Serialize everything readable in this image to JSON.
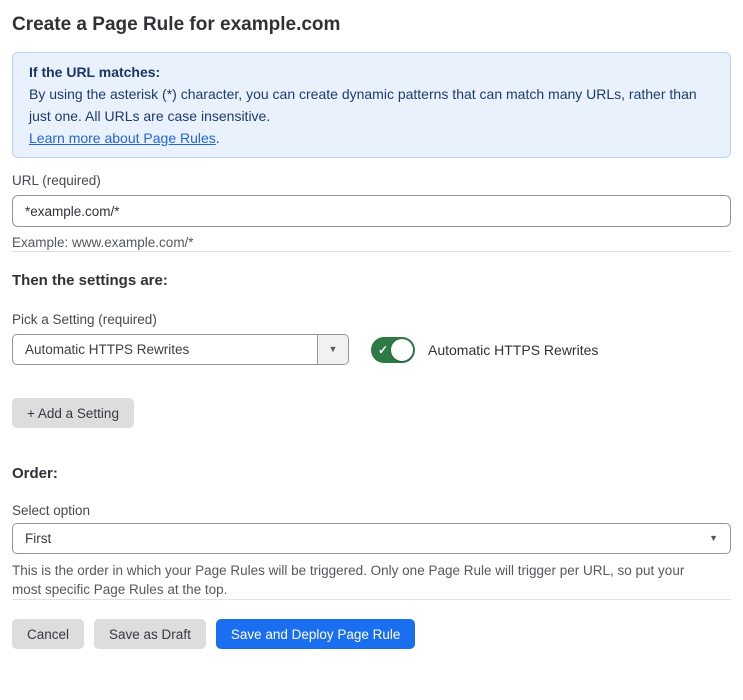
{
  "page": {
    "title": "Create a Page Rule for example.com"
  },
  "info_box": {
    "heading": "If the URL matches:",
    "body": "By using the asterisk (*) character, you can create dynamic patterns that can match many URLs, rather than just one. All URLs are case insensitive.",
    "link_label": "Learn more about Page Rules",
    "link_suffix": "."
  },
  "url_field": {
    "label": "URL (required)",
    "value": "*example.com/*",
    "helper": "Example: www.example.com/*"
  },
  "settings_section": {
    "heading": "Then the settings are:",
    "picker_label": "Pick a Setting (required)",
    "picker_value": "Automatic HTTPS Rewrites",
    "toggle_state": "on",
    "toggle_check_glyph": "✓",
    "toggle_label": "Automatic HTTPS Rewrites",
    "add_setting_label": "+ Add a Setting"
  },
  "order_section": {
    "heading": "Order:",
    "select_label": "Select option",
    "select_value": "First",
    "helper": "This is the order in which your Page Rules will be triggered. Only one Page Rule will trigger per URL, so put your most specific Page Rules at the top."
  },
  "footer": {
    "cancel_label": "Cancel",
    "save_draft_label": "Save as Draft",
    "deploy_label": "Save and Deploy Page Rule"
  },
  "icons": {
    "caret_down": "▼"
  },
  "colors": {
    "accent_blue": "#1a6ef0",
    "link_blue": "#2365d8",
    "info_bg": "#e9f2fc",
    "info_border": "#b9d3f0",
    "info_text": "#1e3a6d",
    "toggle_green": "#2d7a46",
    "button_gray": "#dddddd"
  }
}
